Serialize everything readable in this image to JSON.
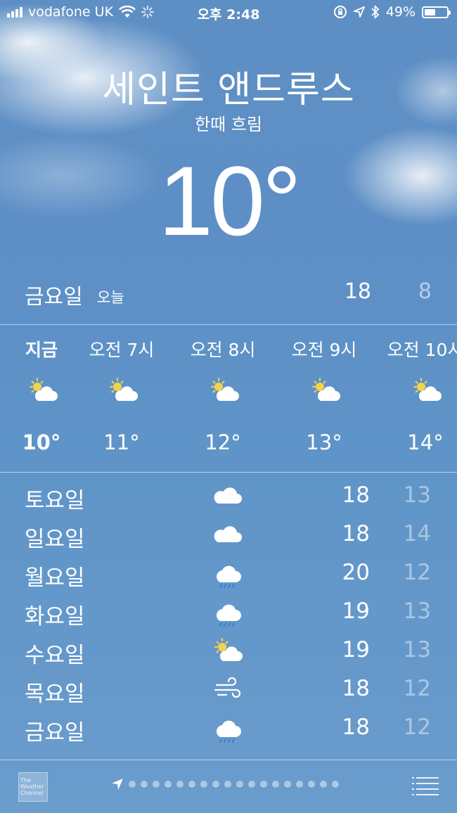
{
  "status_bar": {
    "carrier": "vodafone UK",
    "time": "오후 2:48",
    "battery": "49%",
    "battery_level": 0.49
  },
  "header": {
    "city": "세인트 앤드루스",
    "condition": "한때 흐림",
    "temperature": "10°"
  },
  "today": {
    "day": "금요일",
    "label": "오늘",
    "high": "18",
    "low": "8"
  },
  "hourly": [
    {
      "time": "지금",
      "icon": "sun-cloud-icon",
      "temp": "10°"
    },
    {
      "time": "오전 7시",
      "icon": "sun-cloud-icon",
      "temp": "11°"
    },
    {
      "time": "오전 8시",
      "icon": "sun-cloud-icon",
      "temp": "12°"
    },
    {
      "time": "오전 9시",
      "icon": "sun-cloud-icon",
      "temp": "13°"
    },
    {
      "time": "오전 10시",
      "icon": "sun-cloud-icon",
      "temp": "14°"
    }
  ],
  "daily": [
    {
      "day": "토요일",
      "icon": "cloud-icon",
      "high": "18",
      "low": "13"
    },
    {
      "day": "일요일",
      "icon": "cloud-icon",
      "high": "18",
      "low": "14"
    },
    {
      "day": "월요일",
      "icon": "rain-cloud-icon",
      "high": "20",
      "low": "12"
    },
    {
      "day": "화요일",
      "icon": "rain-cloud-icon",
      "high": "19",
      "low": "13"
    },
    {
      "day": "수요일",
      "icon": "sun-cloud-icon",
      "high": "19",
      "low": "13"
    },
    {
      "day": "목요일",
      "icon": "wind-icon",
      "high": "18",
      "low": "12"
    },
    {
      "day": "금요일",
      "icon": "rain-cloud-icon",
      "high": "18",
      "low": "12"
    }
  ],
  "bottom_bar": {
    "logo_lines": [
      "The",
      "Weather",
      "Channel"
    ],
    "page_count": 18,
    "current_page": 0
  },
  "colors": {
    "sun": "#f6d24a",
    "cloud": "#ffffff",
    "rain": "#3a7fd0"
  }
}
